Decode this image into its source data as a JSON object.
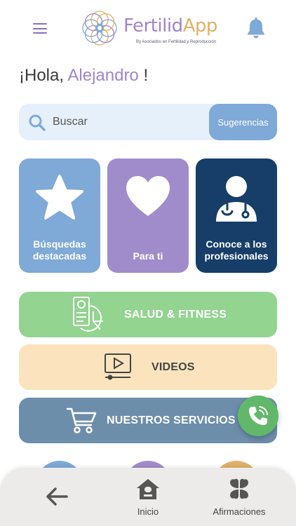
{
  "header": {
    "logo_word_a": "Fertilid",
    "logo_word_b": "App",
    "logo_sub": "By Asociados en Fertilidad y Reproducción"
  },
  "greeting": {
    "prefix": "¡Hola, ",
    "name": "Alejandro",
    "suffix": " !"
  },
  "search": {
    "placeholder": "Buscar",
    "suggestions_label": "Sugerencias"
  },
  "cards": [
    {
      "label": "Búsquedas destacadas",
      "icon": "star-icon",
      "color": "#7fa9d6"
    },
    {
      "label": "Para ti",
      "icon": "heart-icon",
      "color": "#a08cca"
    },
    {
      "label": "Conoce a los profesionales",
      "icon": "doctor-icon",
      "color": "#163e68"
    }
  ],
  "sections": [
    {
      "label": "SALUD & FITNESS",
      "icon": "health-report-icon",
      "color": "#92d490"
    },
    {
      "label": "VIDEOS",
      "icon": "video-player-icon",
      "color": "#fbe4bd"
    },
    {
      "label": "NUESTROS SERVICIOS",
      "icon": "shopping-cart-icon",
      "color": "#6d8eab"
    }
  ],
  "fab": {
    "icon": "phone-icon",
    "color": "#61b86a"
  },
  "bottom_nav": {
    "back_icon": "arrow-left-icon",
    "items": [
      {
        "label": "Inicio",
        "icon": "home-icon"
      },
      {
        "label": "Afirmaciones",
        "icon": "clover-icon"
      }
    ]
  },
  "colors": {
    "accent_purple": "#9f86c9",
    "accent_gold": "#e0b16a"
  }
}
